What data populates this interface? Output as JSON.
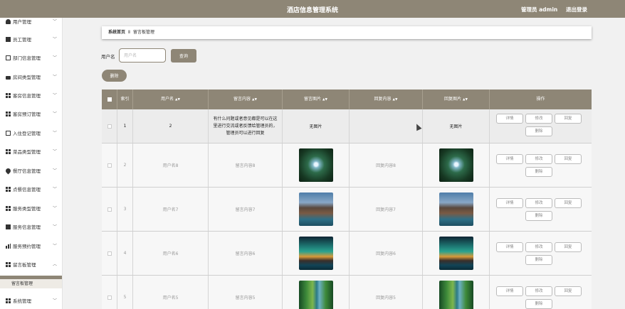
{
  "header": {
    "title": "酒店信息管理系统",
    "admin": "管理员 admin",
    "logout": "退出登录"
  },
  "sidebar": {
    "items": [
      {
        "label": "用户管理",
        "icon": "user-icon"
      },
      {
        "label": "员工管理",
        "icon": "box-icon"
      },
      {
        "label": "部门信息管理",
        "icon": "checkbox-icon"
      },
      {
        "label": "房间类型管理",
        "icon": "bed-icon"
      },
      {
        "label": "客房信息管理",
        "icon": "grid-icon"
      },
      {
        "label": "客房预订管理",
        "icon": "grid-icon"
      },
      {
        "label": "入住登记管理",
        "icon": "checkbox-icon"
      },
      {
        "label": "菜品类型管理",
        "icon": "grid-icon"
      },
      {
        "label": "餐厅信息管理",
        "icon": "pin-icon"
      },
      {
        "label": "点餐信息管理",
        "icon": "grid-icon"
      },
      {
        "label": "服务类型管理",
        "icon": "grid-icon"
      },
      {
        "label": "服务信息管理",
        "icon": "box-icon"
      },
      {
        "label": "服务预约管理",
        "icon": "bars-icon"
      },
      {
        "label": "留言板管理",
        "icon": "grid-icon"
      },
      {
        "label": "系统管理",
        "icon": "grid-icon"
      }
    ],
    "active_sub": "留言板管理"
  },
  "breadcrumb": {
    "home": "系统首页",
    "separator": "Ⅱ",
    "current": "留言板管理"
  },
  "search": {
    "label": "用户名",
    "placeholder": "用户名",
    "value": "",
    "button": "查询"
  },
  "delete_button": "删除",
  "table": {
    "headers": {
      "index": "索引",
      "username": "用户名",
      "content": "留言内容",
      "image": "留言图片",
      "reply": "回复内容",
      "reply_image": "回复图片",
      "ops": "操作"
    },
    "sort_glyph": "▲▼",
    "rows": [
      {
        "index": "1",
        "username": "2",
        "content": "有什么问题或者意见都是可以在这里进行交流或者反馈给管理员的，管理员可以进行回复",
        "image": "无图片",
        "reply": "",
        "reply_image": "无图片"
      },
      {
        "index": "2",
        "username": "用户名8",
        "content": "留言内容8",
        "image": "forest",
        "reply": "回复内容8",
        "reply_image": "forest"
      },
      {
        "index": "3",
        "username": "用户名7",
        "content": "留言内容7",
        "image": "coast",
        "reply": "回复内容7",
        "reply_image": "coast"
      },
      {
        "index": "4",
        "username": "用户名6",
        "content": "留言内容6",
        "image": "aurora",
        "reply": "回复内容6",
        "reply_image": "aurora"
      },
      {
        "index": "5",
        "username": "用户名5",
        "content": "留言内容5",
        "image": "river",
        "reply": "回复内容5",
        "reply_image": "river"
      }
    ],
    "ops": {
      "detail": "详情",
      "edit": "修改",
      "reply": "回复",
      "delete": "删除"
    }
  },
  "colors": {
    "primary": "#8e8676",
    "background": "#f1f1f1",
    "sidebar": "#ffffff"
  }
}
